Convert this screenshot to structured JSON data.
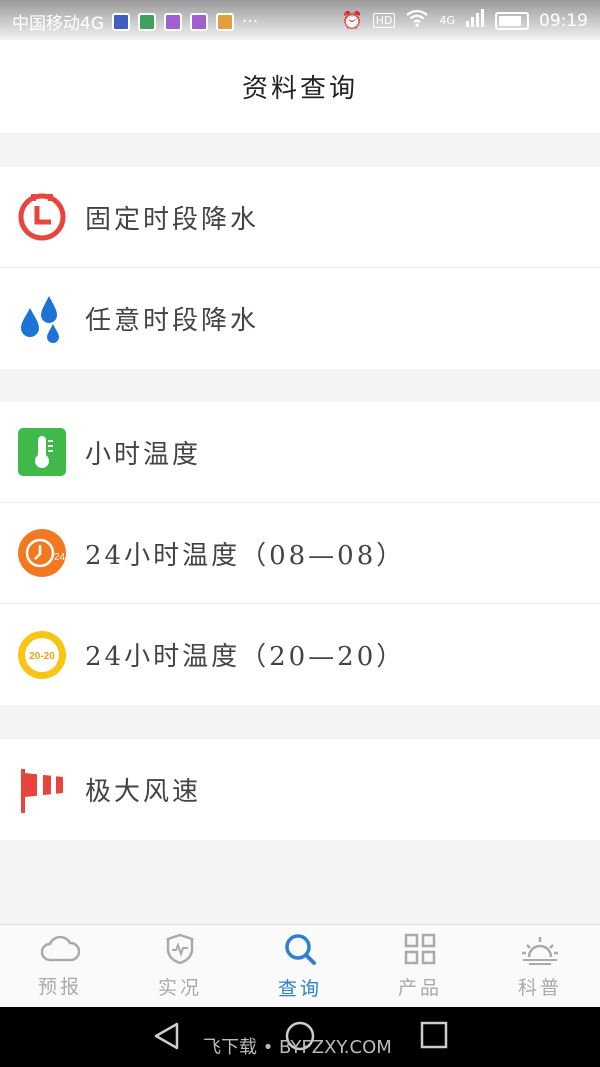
{
  "status_bar": {
    "carrier": "中国移动4G",
    "more": "···",
    "hd": "HD",
    "network": "4G",
    "time": "09:19"
  },
  "header": {
    "title": "资料查询"
  },
  "sections": [
    {
      "items": [
        {
          "label": "固定时段降水",
          "icon": "clock-red-icon"
        },
        {
          "label": "任意时段降水",
          "icon": "raindrops-icon"
        }
      ]
    },
    {
      "items": [
        {
          "label": "小时温度",
          "icon": "thermometer-icon"
        },
        {
          "label": "24小时温度（08—08）",
          "icon": "clock-24-icon",
          "icon_text": "24"
        },
        {
          "label": "24小时温度（20—20）",
          "icon": "badge-20-20-icon",
          "icon_text": "20-20"
        }
      ]
    },
    {
      "items": [
        {
          "label": "极大风速",
          "icon": "windsock-icon"
        }
      ]
    }
  ],
  "tabs": [
    {
      "label": "预报",
      "icon": "cloud-icon",
      "active": false
    },
    {
      "label": "实况",
      "icon": "shield-pulse-icon",
      "active": false
    },
    {
      "label": "查询",
      "icon": "search-icon",
      "active": true
    },
    {
      "label": "产品",
      "icon": "grid-icon",
      "active": false
    },
    {
      "label": "科普",
      "icon": "sunrise-icon",
      "active": false
    }
  ],
  "watermark": "飞下载 • BYFZXY.COM",
  "colors": {
    "accent": "#2d7fd6",
    "red": "#e8453c",
    "blue": "#1e73d8",
    "green": "#3fba4a",
    "orange": "#f2791f",
    "yellow": "#f7c513"
  }
}
